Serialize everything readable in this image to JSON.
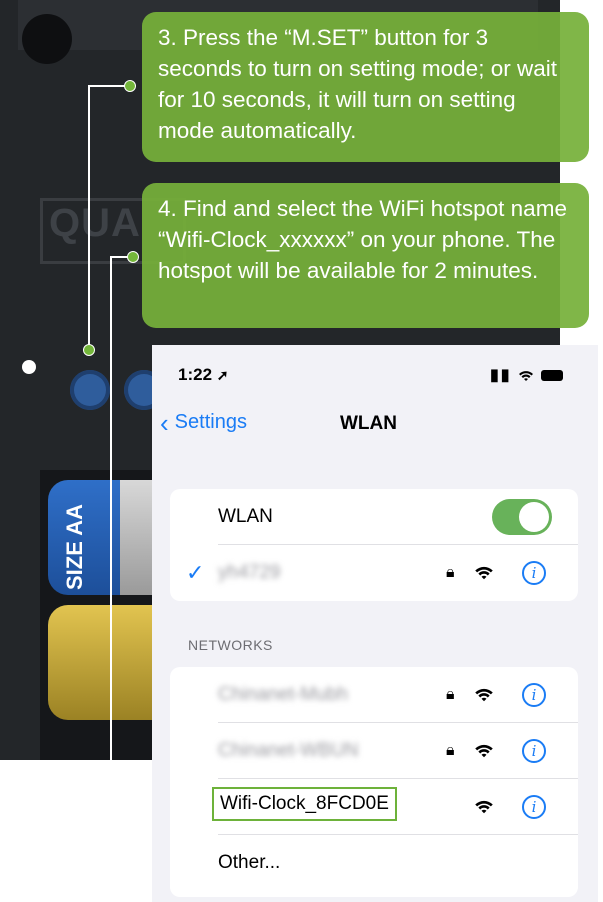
{
  "device": {
    "logo_text": "QUA",
    "battery_label": "SIZE AA"
  },
  "callouts": [
    {
      "text": "3. Press the “M.SET” button for 3 seconds to turn on setting mode; or wait for 10 seconds, it will turn on setting mode automatically."
    },
    {
      "text": "4. Find and select the WiFi hotspot name “Wifi-Clock_xxxxxx” on your phone. The hotspot will be available for 2 minutes."
    }
  ],
  "status_bar": {
    "time": "1:22",
    "location_icon": "location-arrow-icon",
    "icons": "signal-wifi-battery-icons"
  },
  "nav": {
    "back_label": "Settings",
    "title": "WLAN"
  },
  "wlan": {
    "label": "WLAN",
    "enabled": true,
    "connected_network": "yh4729"
  },
  "networks": {
    "header": "NETWORKS",
    "items": [
      {
        "name": "Chinanet-Mubh",
        "locked": true
      },
      {
        "name": "Chinanet-WBUN",
        "locked": true
      },
      {
        "name": "Wifi-Clock_8FCD0E",
        "locked": false,
        "highlighted": true
      }
    ],
    "other_label": "Other..."
  },
  "colors": {
    "accent_green": "#76b03a",
    "ios_blue": "#1a7cf5",
    "toggle_green": "#68b25a"
  }
}
